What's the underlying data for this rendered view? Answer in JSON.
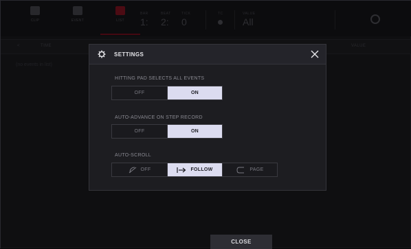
{
  "toolbar": {
    "clip_label": "CLIP",
    "event_label": "EVENT",
    "active_label": "LIST",
    "bar_caption": "BAR",
    "beat_caption": "BEAT",
    "tick_caption": "TICK",
    "bar_value": "1:",
    "beat_value": "2:",
    "tick_value": "0",
    "tc_caption": "TC",
    "view_caption": "VALUE",
    "view_value": "All"
  },
  "list_header": {
    "col_left": "TIME",
    "col_right": "VALUE",
    "empty_message": "(no events in list)"
  },
  "modal": {
    "title": "SETTINGS",
    "sections": [
      {
        "label": "HITTING PAD SELECTS ALL EVENTS",
        "options": [
          "OFF",
          "ON"
        ],
        "selected": "ON"
      },
      {
        "label": "AUTO-ADVANCE ON STEP RECORD",
        "options": [
          "OFF",
          "ON"
        ],
        "selected": "ON"
      },
      {
        "label": "AUTO-SCROLL",
        "options": [
          "OFF",
          "FOLLOW",
          "PAGE"
        ],
        "selected": "FOLLOW"
      }
    ]
  },
  "close_label": "CLOSE",
  "colors": {
    "accent": "#8a1424",
    "selected_bg": "#dcdcf0",
    "modal_bg": "#1d1d21"
  },
  "icons": {
    "modal_header": "gear-icon",
    "close": "close-icon",
    "scroll_off": "scroll-off-icon",
    "scroll_follow": "arrow-right-bar-icon",
    "scroll_page": "page-curve-icon"
  }
}
